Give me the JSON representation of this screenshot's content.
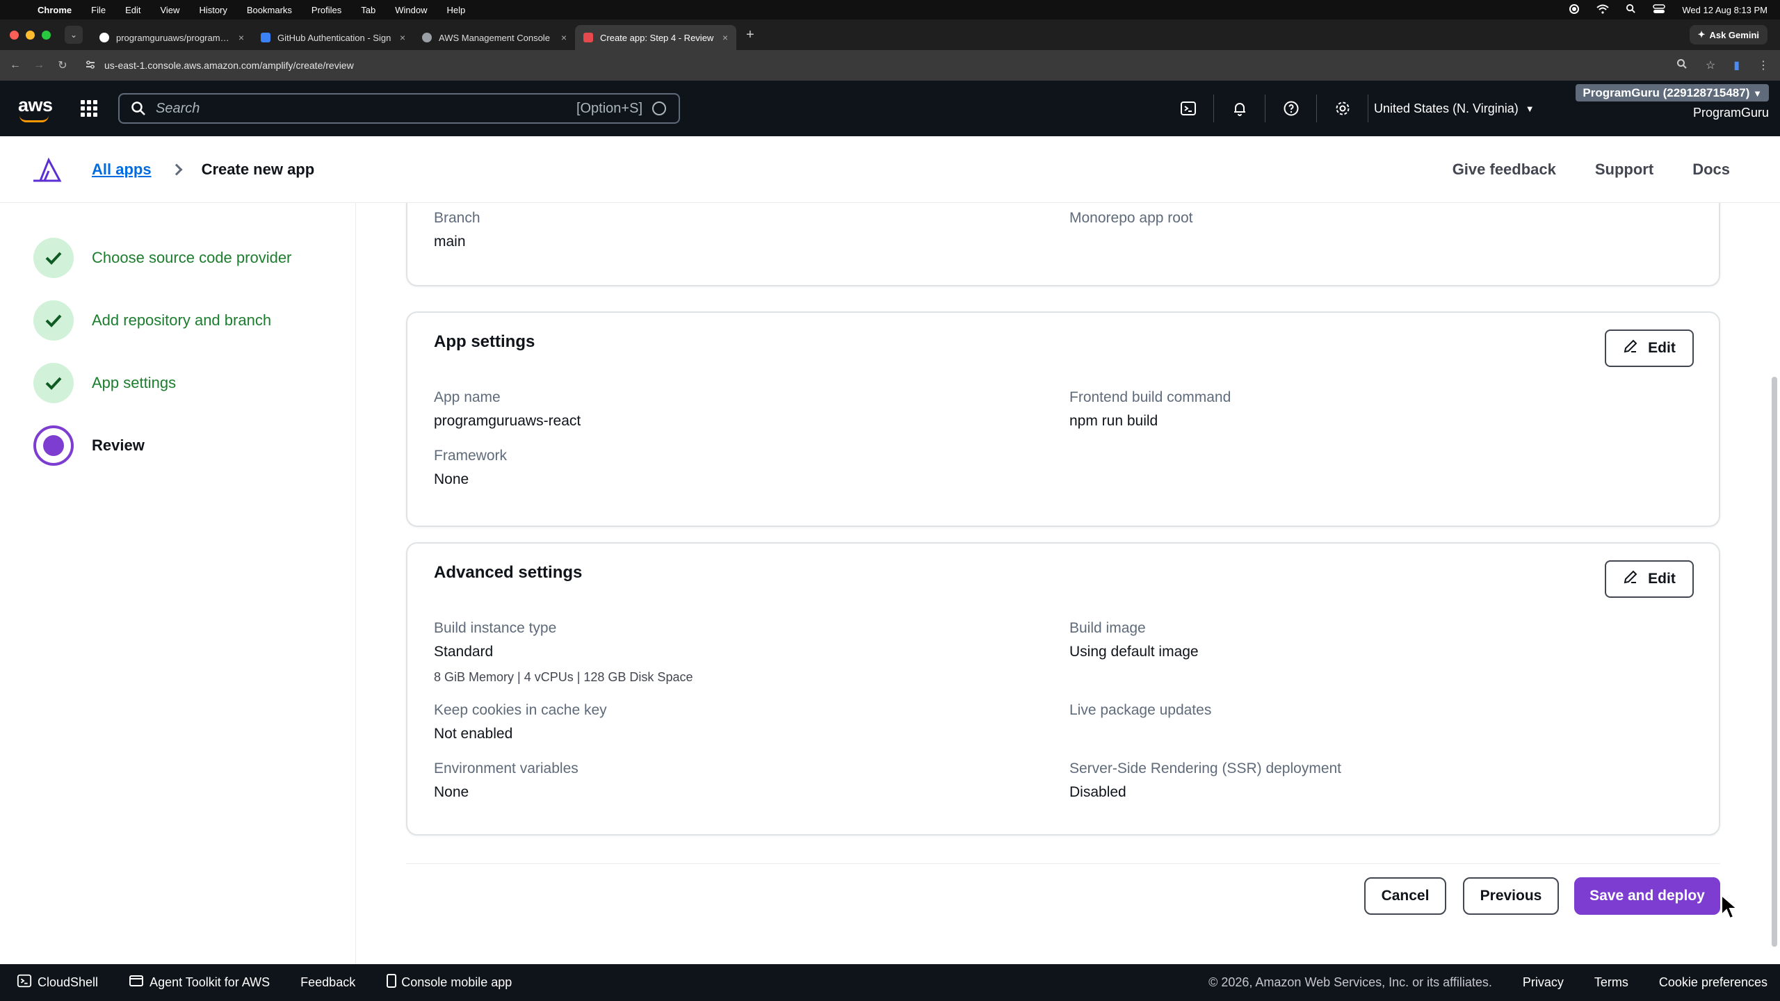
{
  "menubar": {
    "app": "Chrome",
    "items": [
      "File",
      "Edit",
      "View",
      "History",
      "Bookmarks",
      "Profiles",
      "Tab",
      "Window",
      "Help"
    ],
    "clock": "Wed 12 Aug  8:13 PM"
  },
  "tabs": [
    {
      "title": "programguruaws/programguru",
      "favicon_color": "#ffffff"
    },
    {
      "title": "GitHub Authentication - Sign",
      "favicon_color": "#3b82f6"
    },
    {
      "title": "AWS Management Console",
      "favicon_color": "#9aa0a6"
    },
    {
      "title": "Create app: Step 4 - Review",
      "favicon_color": "#e5484d"
    }
  ],
  "ask_gemini": "Ask Gemini",
  "address": {
    "url": "us-east-1.console.aws.amazon.com/amplify/create/review"
  },
  "awsnav": {
    "search_placeholder": "Search",
    "search_shortcut": "[Option+S]",
    "region": "United States (N. Virginia)",
    "account_chip": "ProgramGuru (229128715487)",
    "account_name": "ProgramGuru"
  },
  "header": {
    "breadcrumb_link": "All apps",
    "breadcrumb_current": "Create new app",
    "links": [
      "Give feedback",
      "Support",
      "Docs"
    ]
  },
  "steps": [
    {
      "label": "Choose source code provider",
      "state": "done"
    },
    {
      "label": "Add repository and branch",
      "state": "done"
    },
    {
      "label": "App settings",
      "state": "done"
    },
    {
      "label": "Review",
      "state": "current"
    }
  ],
  "repo_card": {
    "branch_label": "Branch",
    "branch_value": "main",
    "monorepo_label": "Monorepo app root"
  },
  "app_settings": {
    "title": "App settings",
    "edit": "Edit",
    "app_name_label": "App name",
    "app_name_value": "programguruaws-react",
    "build_cmd_label": "Frontend build command",
    "build_cmd_value": "npm run build",
    "framework_label": "Framework",
    "framework_value": "None"
  },
  "advanced": {
    "title": "Advanced settings",
    "edit": "Edit",
    "instance_label": "Build instance type",
    "instance_value": "Standard",
    "instance_sub": "8 GiB Memory | 4 vCPUs | 128 GB Disk Space",
    "image_label": "Build image",
    "image_value": "Using default image",
    "cookies_label": "Keep cookies in cache key",
    "cookies_value": "Not enabled",
    "live_label": "Live package updates",
    "env_label": "Environment variables",
    "env_value": "None",
    "ssr_label": "Server-Side Rendering (SSR) deployment",
    "ssr_value": "Disabled"
  },
  "actions": {
    "cancel": "Cancel",
    "previous": "Previous",
    "save": "Save and deploy"
  },
  "footer": {
    "cloudshell": "CloudShell",
    "toolkit": "Agent Toolkit for AWS",
    "feedback": "Feedback",
    "mobile": "Console mobile app",
    "copyright": "© 2026, Amazon Web Services, Inc. or its affiliates.",
    "privacy": "Privacy",
    "terms": "Terms",
    "cookies": "Cookie preferences"
  },
  "colors": {
    "primary": "#7d3dd1",
    "success_bg": "#d1f2d9",
    "success_text": "#1b7d2d",
    "link": "#006ce0",
    "aws_orange": "#ff9900"
  }
}
